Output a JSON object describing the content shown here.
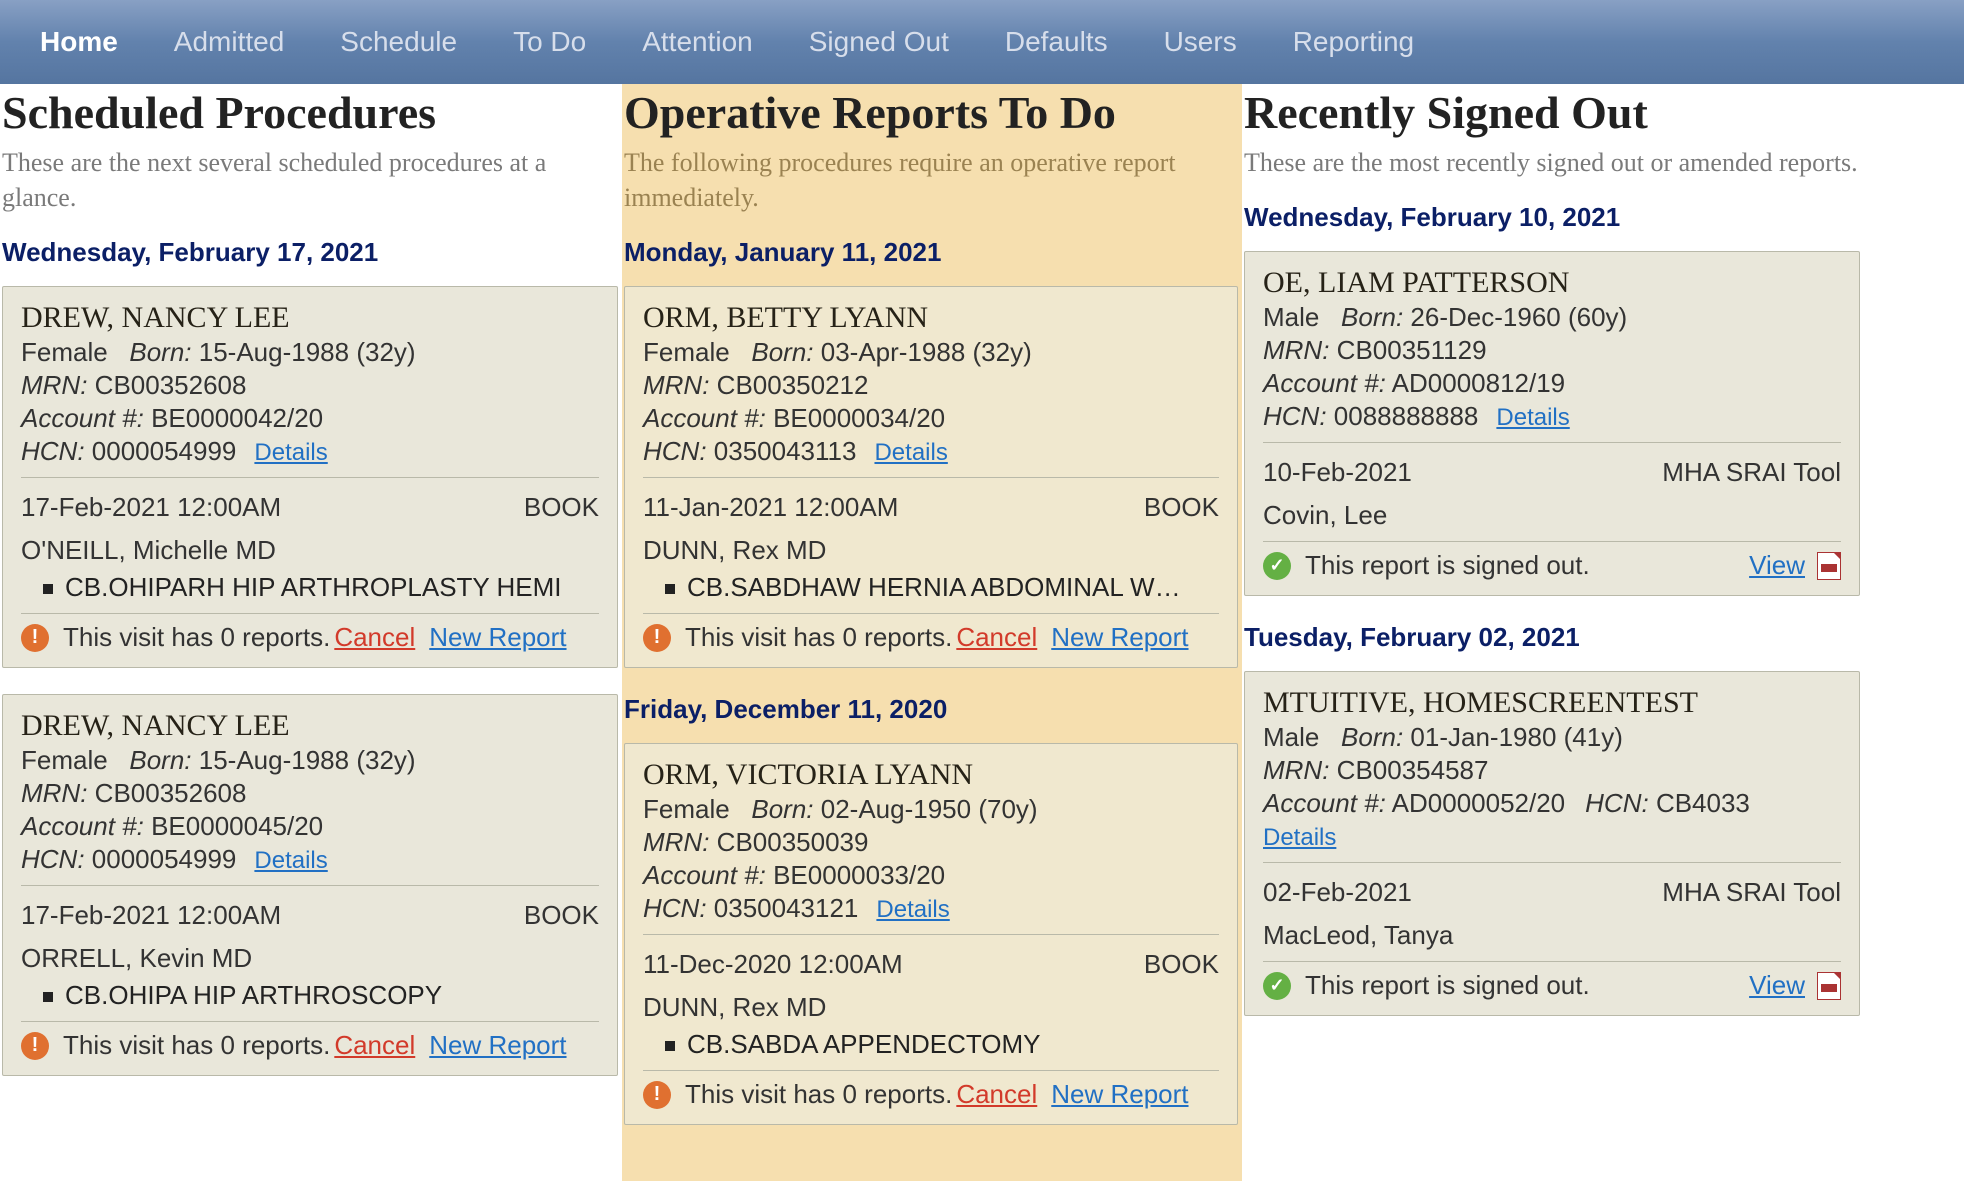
{
  "nav": {
    "items": [
      "Home",
      "Admitted",
      "Schedule",
      "To Do",
      "Attention",
      "Signed Out",
      "Defaults",
      "Users",
      "Reporting"
    ],
    "activeIndex": 0
  },
  "labels": {
    "born": "Born:",
    "mrn": "MRN:",
    "account": "Account #:",
    "hcn": "HCN:",
    "details": "Details",
    "cancel": "Cancel",
    "newReport": "New Report",
    "zeroReports": "This visit has 0 reports.",
    "signedOut": "This report is signed out.",
    "view": "View"
  },
  "col1": {
    "title": "Scheduled Procedures",
    "subtitle": "These are the next several scheduled procedures at a glance.",
    "groups": [
      {
        "date": "Wednesday, February 17, 2021",
        "cards": [
          {
            "name": "DREW, NANCY LEE",
            "gender": "Female",
            "born": "15-Aug-1988 (32y)",
            "mrn": "CB00352608",
            "account": "BE0000042/20",
            "hcn": "0000054999",
            "when": "17-Feb-2021 12:00AM",
            "status": "BOOK",
            "physician": "O'NEILL, Michelle MD",
            "procedure": "CB.OHIPARH HIP ARTHROPLASTY HEMI"
          },
          {
            "name": "DREW, NANCY LEE",
            "gender": "Female",
            "born": "15-Aug-1988 (32y)",
            "mrn": "CB00352608",
            "account": "BE0000045/20",
            "hcn": "0000054999",
            "when": "17-Feb-2021 12:00AM",
            "status": "BOOK",
            "physician": "ORRELL, Kevin MD",
            "procedure": "CB.OHIPA HIP ARTHROSCOPY"
          }
        ]
      }
    ]
  },
  "col2": {
    "title": "Operative Reports To Do",
    "subtitle": "The following procedures require an operative report immediately.",
    "groups": [
      {
        "date": "Monday, January 11, 2021",
        "cards": [
          {
            "name": "ORM, BETTY LYANN",
            "gender": "Female",
            "born": "03-Apr-1988 (32y)",
            "mrn": "CB00350212",
            "account": "BE0000034/20",
            "hcn": "0350043113",
            "when": "11-Jan-2021 12:00AM",
            "status": "BOOK",
            "physician": "DUNN, Rex MD",
            "procedure": "CB.SABDHAW HERNIA ABDOMINAL W…"
          }
        ]
      },
      {
        "date": "Friday, December 11, 2020",
        "cards": [
          {
            "name": "ORM, VICTORIA LYANN",
            "gender": "Female",
            "born": "02-Aug-1950 (70y)",
            "mrn": "CB00350039",
            "account": "BE0000033/20",
            "hcn": "0350043121",
            "when": "11-Dec-2020 12:00AM",
            "status": "BOOK",
            "physician": "DUNN, Rex MD",
            "procedure": "CB.SABDA APPENDECTOMY"
          }
        ]
      }
    ]
  },
  "col3": {
    "title": "Recently Signed Out",
    "subtitle": "These are the most recently signed out or amended reports.",
    "groups": [
      {
        "date": "Wednesday, February 10, 2021",
        "cards": [
          {
            "name": "OE, LIAM PATTERSON",
            "gender": "Male",
            "born": "26-Dec-1960 (60y)",
            "mrn": "CB00351129",
            "account": "AD0000812/19",
            "hcn": "0088888888",
            "when": "10-Feb-2021",
            "tool": "MHA SRAI Tool",
            "signer": "Covin, Lee"
          }
        ]
      },
      {
        "date": "Tuesday, February 02, 2021",
        "cards": [
          {
            "name": "MTUITIVE, HOMESCREENTEST",
            "gender": "Male",
            "born": "01-Jan-1980 (41y)",
            "mrn": "CB00354587",
            "account": "AD0000052/20",
            "hcn": "CB4033",
            "hcnInline": true,
            "when": "02-Feb-2021",
            "tool": "MHA SRAI Tool",
            "signer": "MacLeod, Tanya"
          }
        ]
      }
    ]
  }
}
